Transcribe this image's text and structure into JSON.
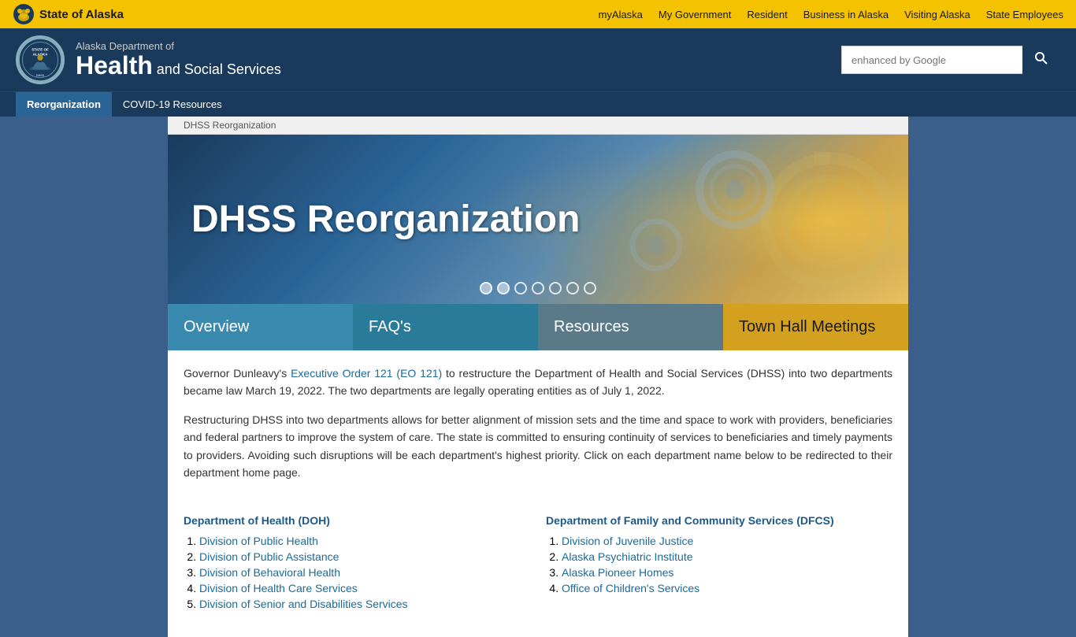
{
  "topbar": {
    "state_name": "State of Alaska",
    "nav_links": [
      {
        "label": "myAlaska",
        "id": "myalaska"
      },
      {
        "label": "My Government",
        "id": "my-government"
      },
      {
        "label": "Resident",
        "id": "resident"
      },
      {
        "label": "Business in Alaska",
        "id": "business"
      },
      {
        "label": "Visiting Alaska",
        "id": "visiting"
      },
      {
        "label": "State Employees",
        "id": "employees"
      }
    ]
  },
  "header": {
    "dept_line1": "Alaska Department of",
    "dept_health": "Health",
    "dept_and": " and ",
    "dept_social_services": "Social Services",
    "search_placeholder": "enhanced by Google",
    "search_button_label": "🔍"
  },
  "nav": {
    "items": [
      {
        "label": "Reorganization",
        "active": true
      },
      {
        "label": "COVID-19 Resources",
        "active": false
      }
    ]
  },
  "breadcrumb": {
    "text": "DHSS Reorganization"
  },
  "hero": {
    "title": "DHSS Reorganization",
    "dots": [
      {
        "active": true
      },
      {
        "active": false
      },
      {
        "active": false
      },
      {
        "active": false
      },
      {
        "active": false
      },
      {
        "active": false
      },
      {
        "active": false
      }
    ]
  },
  "tabs": [
    {
      "label": "Overview",
      "class": "tab-overview"
    },
    {
      "label": "FAQ's",
      "class": "tab-faqs"
    },
    {
      "label": "Resources",
      "class": "tab-resources"
    },
    {
      "label": "Town Hall Meetings",
      "class": "tab-townhall"
    }
  ],
  "content": {
    "para1_prefix": "Governor Dunleavy's ",
    "para1_link": "Executive Order 121 (EO 121)",
    "para1_suffix": " to restructure the Department of Health and Social Services (DHSS) into two departments became law March 19, 2022. The two departments are legally operating entities as of July 1, 2022.",
    "para2": "Restructuring DHSS into two departments allows for better alignment of mission sets and the time and space to work with providers, beneficiaries and federal partners to improve the system of care. The state is committed to ensuring continuity of services to beneficiaries and timely payments to providers. Avoiding such disruptions will be each department's highest priority. Click on each department name below to be redirected to their department home page."
  },
  "departments": {
    "doh": {
      "title": "Department of Health (DOH)",
      "items": [
        "Division of Public Health",
        "Division of Public Assistance",
        "Division of Behavioral Health",
        "Division of Health Care Services",
        "Division of Senior and Disabilities Services"
      ]
    },
    "dfcs": {
      "title": "Department of Family and Community Services (DFCS)",
      "items": [
        "Division of Juvenile Justice",
        "Alaska Psychiatric Institute",
        "Alaska Pioneer Homes",
        "Office of Children's Services"
      ]
    }
  },
  "seal": {
    "text": "STATE OF ALASKA DHSS"
  }
}
